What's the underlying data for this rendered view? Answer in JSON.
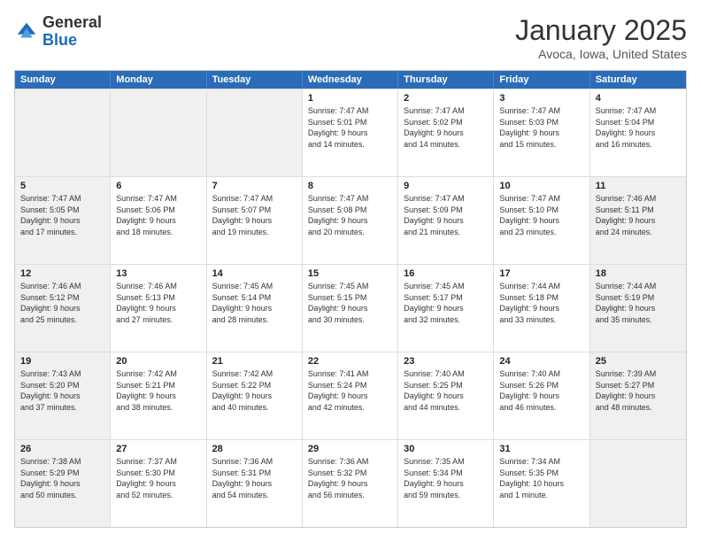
{
  "logo": {
    "general": "General",
    "blue": "Blue"
  },
  "header": {
    "title": "January 2025",
    "location": "Avoca, Iowa, United States"
  },
  "weekdays": [
    "Sunday",
    "Monday",
    "Tuesday",
    "Wednesday",
    "Thursday",
    "Friday",
    "Saturday"
  ],
  "rows": [
    [
      {
        "day": "",
        "info": "",
        "shaded": true
      },
      {
        "day": "",
        "info": "",
        "shaded": true
      },
      {
        "day": "",
        "info": "",
        "shaded": true
      },
      {
        "day": "1",
        "info": "Sunrise: 7:47 AM\nSunset: 5:01 PM\nDaylight: 9 hours\nand 14 minutes.",
        "shaded": false
      },
      {
        "day": "2",
        "info": "Sunrise: 7:47 AM\nSunset: 5:02 PM\nDaylight: 9 hours\nand 14 minutes.",
        "shaded": false
      },
      {
        "day": "3",
        "info": "Sunrise: 7:47 AM\nSunset: 5:03 PM\nDaylight: 9 hours\nand 15 minutes.",
        "shaded": false
      },
      {
        "day": "4",
        "info": "Sunrise: 7:47 AM\nSunset: 5:04 PM\nDaylight: 9 hours\nand 16 minutes.",
        "shaded": false
      }
    ],
    [
      {
        "day": "5",
        "info": "Sunrise: 7:47 AM\nSunset: 5:05 PM\nDaylight: 9 hours\nand 17 minutes.",
        "shaded": true
      },
      {
        "day": "6",
        "info": "Sunrise: 7:47 AM\nSunset: 5:06 PM\nDaylight: 9 hours\nand 18 minutes.",
        "shaded": false
      },
      {
        "day": "7",
        "info": "Sunrise: 7:47 AM\nSunset: 5:07 PM\nDaylight: 9 hours\nand 19 minutes.",
        "shaded": false
      },
      {
        "day": "8",
        "info": "Sunrise: 7:47 AM\nSunset: 5:08 PM\nDaylight: 9 hours\nand 20 minutes.",
        "shaded": false
      },
      {
        "day": "9",
        "info": "Sunrise: 7:47 AM\nSunset: 5:09 PM\nDaylight: 9 hours\nand 21 minutes.",
        "shaded": false
      },
      {
        "day": "10",
        "info": "Sunrise: 7:47 AM\nSunset: 5:10 PM\nDaylight: 9 hours\nand 23 minutes.",
        "shaded": false
      },
      {
        "day": "11",
        "info": "Sunrise: 7:46 AM\nSunset: 5:11 PM\nDaylight: 9 hours\nand 24 minutes.",
        "shaded": true
      }
    ],
    [
      {
        "day": "12",
        "info": "Sunrise: 7:46 AM\nSunset: 5:12 PM\nDaylight: 9 hours\nand 25 minutes.",
        "shaded": true
      },
      {
        "day": "13",
        "info": "Sunrise: 7:46 AM\nSunset: 5:13 PM\nDaylight: 9 hours\nand 27 minutes.",
        "shaded": false
      },
      {
        "day": "14",
        "info": "Sunrise: 7:45 AM\nSunset: 5:14 PM\nDaylight: 9 hours\nand 28 minutes.",
        "shaded": false
      },
      {
        "day": "15",
        "info": "Sunrise: 7:45 AM\nSunset: 5:15 PM\nDaylight: 9 hours\nand 30 minutes.",
        "shaded": false
      },
      {
        "day": "16",
        "info": "Sunrise: 7:45 AM\nSunset: 5:17 PM\nDaylight: 9 hours\nand 32 minutes.",
        "shaded": false
      },
      {
        "day": "17",
        "info": "Sunrise: 7:44 AM\nSunset: 5:18 PM\nDaylight: 9 hours\nand 33 minutes.",
        "shaded": false
      },
      {
        "day": "18",
        "info": "Sunrise: 7:44 AM\nSunset: 5:19 PM\nDaylight: 9 hours\nand 35 minutes.",
        "shaded": true
      }
    ],
    [
      {
        "day": "19",
        "info": "Sunrise: 7:43 AM\nSunset: 5:20 PM\nDaylight: 9 hours\nand 37 minutes.",
        "shaded": true
      },
      {
        "day": "20",
        "info": "Sunrise: 7:42 AM\nSunset: 5:21 PM\nDaylight: 9 hours\nand 38 minutes.",
        "shaded": false
      },
      {
        "day": "21",
        "info": "Sunrise: 7:42 AM\nSunset: 5:22 PM\nDaylight: 9 hours\nand 40 minutes.",
        "shaded": false
      },
      {
        "day": "22",
        "info": "Sunrise: 7:41 AM\nSunset: 5:24 PM\nDaylight: 9 hours\nand 42 minutes.",
        "shaded": false
      },
      {
        "day": "23",
        "info": "Sunrise: 7:40 AM\nSunset: 5:25 PM\nDaylight: 9 hours\nand 44 minutes.",
        "shaded": false
      },
      {
        "day": "24",
        "info": "Sunrise: 7:40 AM\nSunset: 5:26 PM\nDaylight: 9 hours\nand 46 minutes.",
        "shaded": false
      },
      {
        "day": "25",
        "info": "Sunrise: 7:39 AM\nSunset: 5:27 PM\nDaylight: 9 hours\nand 48 minutes.",
        "shaded": true
      }
    ],
    [
      {
        "day": "26",
        "info": "Sunrise: 7:38 AM\nSunset: 5:29 PM\nDaylight: 9 hours\nand 50 minutes.",
        "shaded": true
      },
      {
        "day": "27",
        "info": "Sunrise: 7:37 AM\nSunset: 5:30 PM\nDaylight: 9 hours\nand 52 minutes.",
        "shaded": false
      },
      {
        "day": "28",
        "info": "Sunrise: 7:36 AM\nSunset: 5:31 PM\nDaylight: 9 hours\nand 54 minutes.",
        "shaded": false
      },
      {
        "day": "29",
        "info": "Sunrise: 7:36 AM\nSunset: 5:32 PM\nDaylight: 9 hours\nand 56 minutes.",
        "shaded": false
      },
      {
        "day": "30",
        "info": "Sunrise: 7:35 AM\nSunset: 5:34 PM\nDaylight: 9 hours\nand 59 minutes.",
        "shaded": false
      },
      {
        "day": "31",
        "info": "Sunrise: 7:34 AM\nSunset: 5:35 PM\nDaylight: 10 hours\nand 1 minute.",
        "shaded": false
      },
      {
        "day": "",
        "info": "",
        "shaded": true
      }
    ]
  ]
}
